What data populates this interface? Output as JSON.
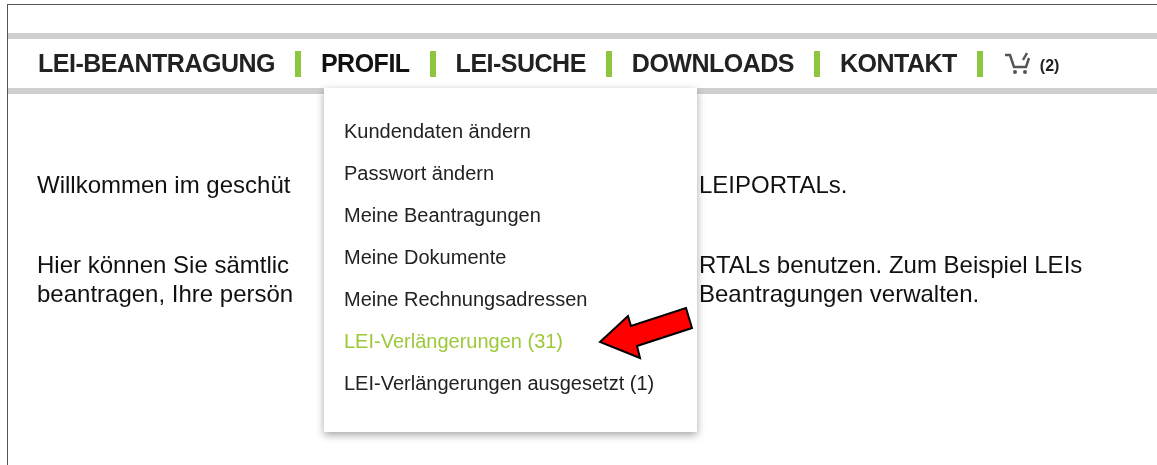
{
  "nav": {
    "items": [
      {
        "label": "LEI-BEANTRAGUNG",
        "selected": false
      },
      {
        "label": "PROFIL",
        "selected": true
      },
      {
        "label": "LEI-SUCHE",
        "selected": false
      },
      {
        "label": "DOWNLOADS",
        "selected": false
      },
      {
        "label": "KONTAKT",
        "selected": false
      }
    ],
    "cart_count": "(2)"
  },
  "content": {
    "paragraphs": [
      {
        "lines": [
          {
            "left": "Willkommen im geschüt",
            "right": "LEIPORTALs."
          }
        ]
      },
      {
        "lines": [
          {
            "left": "Hier können Sie sämtlic",
            "right": "RTALs benutzen. Zum Beispiel LEIs"
          },
          {
            "left": "beantragen, Ihre persön",
            "right": "Beantragungen verwalten."
          }
        ]
      }
    ]
  },
  "dropdown": {
    "items": [
      {
        "label": "Kundendaten ändern",
        "selected": false
      },
      {
        "label": "Passwort ändern",
        "selected": false
      },
      {
        "label": "Meine Beantragungen",
        "selected": false
      },
      {
        "label": "Meine Dokumente",
        "selected": false
      },
      {
        "label": "Meine Rechnungsadressen",
        "selected": false
      },
      {
        "label": "LEI-Verlängerungen (31)",
        "selected": true
      },
      {
        "label": "LEI-Verlängerungen ausgesetzt (1)",
        "selected": false
      }
    ]
  }
}
